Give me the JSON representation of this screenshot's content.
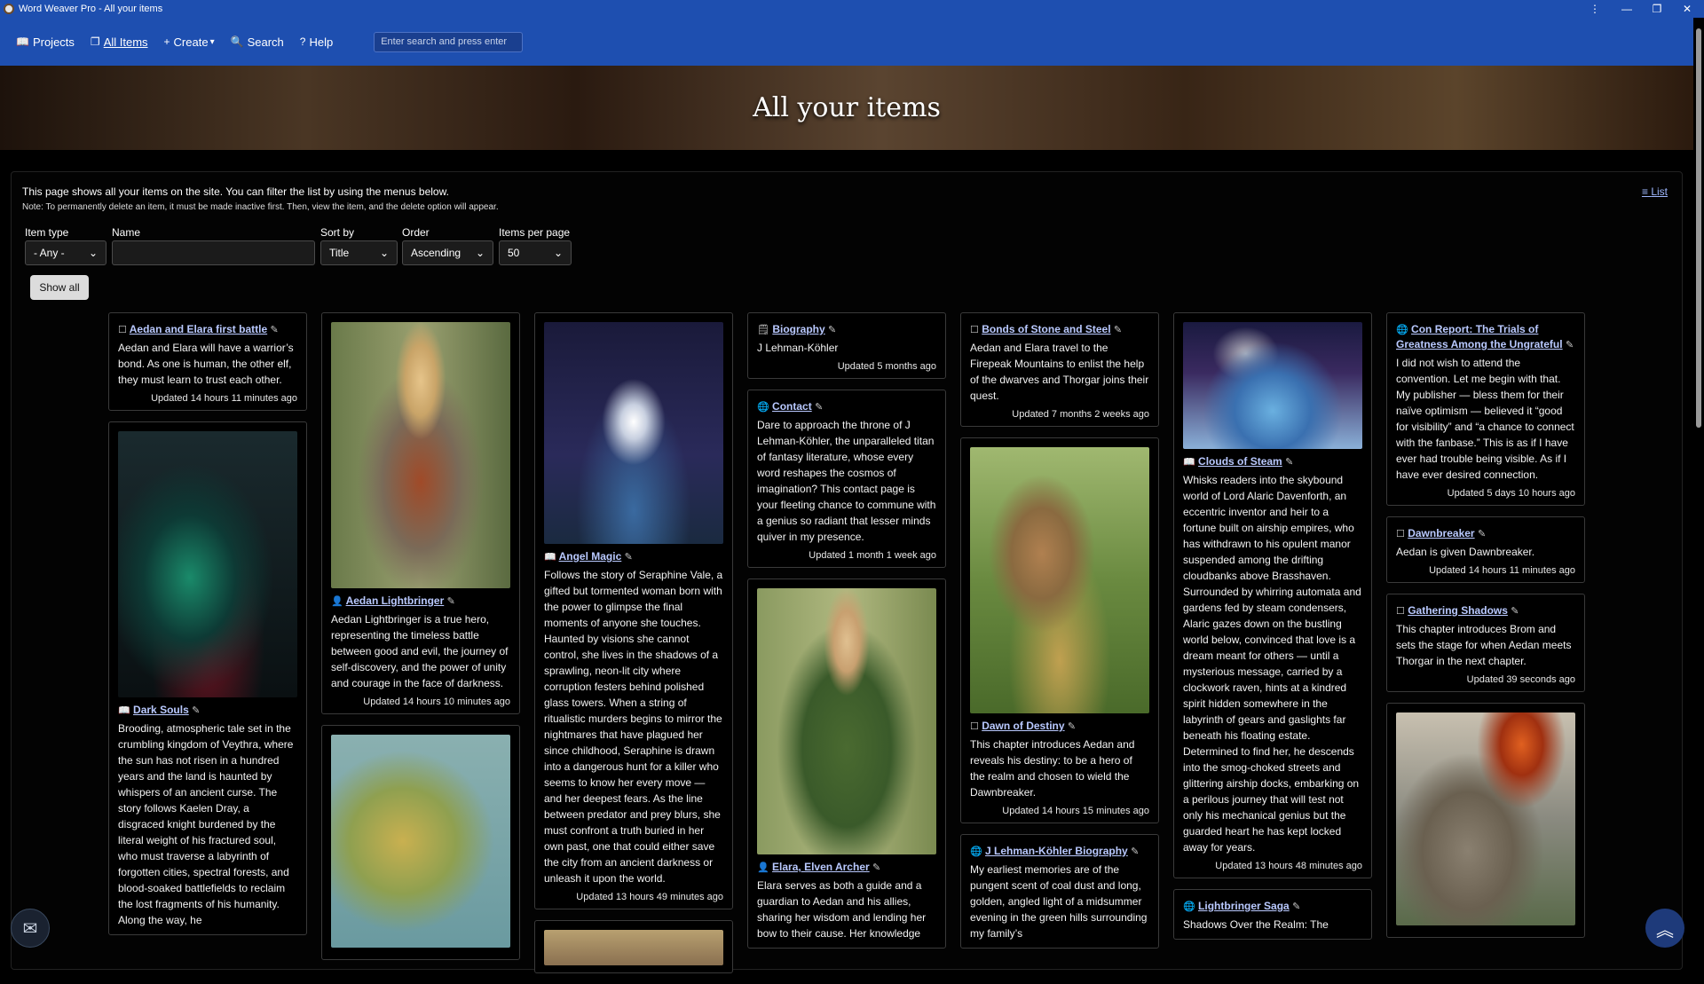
{
  "window": {
    "title": "Word Weaver Pro - All your items",
    "menu_icon": "⋮",
    "minimize_icon": "—",
    "maximize_icon": "❐",
    "close_icon": "✕"
  },
  "nav": {
    "projects": {
      "icon": "📖",
      "label": "Projects"
    },
    "all_items": {
      "icon": "❐",
      "label": "All Items"
    },
    "create": {
      "icon": "+",
      "label": "Create",
      "caret": "▾"
    },
    "search": {
      "icon": "🔍",
      "label": "Search"
    },
    "help": {
      "icon": "?",
      "label": "Help"
    },
    "search_placeholder": "Enter search and press enter"
  },
  "banner": {
    "title": "All your items"
  },
  "intro": {
    "line1": "This page shows all your items on the site. You can filter the list by using the menus below.",
    "line2": "Note: To permanently delete an item, it must be made inactive first. Then, view the item, and the delete option will appear."
  },
  "list_link": {
    "icon": "≡",
    "label": "List"
  },
  "filters": {
    "item_type": {
      "label": "Item type",
      "value": "- Any -"
    },
    "name": {
      "label": "Name",
      "value": ""
    },
    "sort_by": {
      "label": "Sort by",
      "value": "Title"
    },
    "order": {
      "label": "Order",
      "value": "Ascending"
    },
    "per_page": {
      "label": "Items per page",
      "value": "50"
    },
    "caret": "⌄"
  },
  "show_all": "Show all",
  "icons": {
    "edit": "✎",
    "page": "☐",
    "book": "📖",
    "person": "👤",
    "globe": "🌐",
    "note": "🗒"
  },
  "cards": {
    "c1": {
      "title": "Aedan and Elara first battle",
      "body": "Aedan and Elara will have a warrior’s bond. As one is human, the other elf, they must learn to trust each other.",
      "updated": "Updated 14 hours 11 minutes ago"
    },
    "c2": {
      "title": "Dark Souls",
      "body": "Brooding, atmospheric tale set in the crumbling kingdom of Veythra, where the sun has not risen in a hundred years and the land is haunted by whispers of an ancient curse. The story follows Kaelen Dray, a disgraced knight burdened by the literal weight of his fractured soul, who must traverse a labyrinth of forgotten cities, spectral forests, and blood-soaked battlefields to reclaim the lost fragments of his humanity. Along the way, he"
    },
    "c3": {
      "title": "Aedan Lightbringer",
      "body": "Aedan Lightbringer is a true hero, representing the timeless battle between good and evil, the journey of self-discovery, and the power of unity and courage in the face of darkness.",
      "updated": "Updated 14 hours 10 minutes ago"
    },
    "c5": {
      "title": "Angel Magic",
      "body": "Follows the story of Seraphine Vale, a gifted but tormented woman born with the power to glimpse the final moments of anyone she touches. Haunted by visions she cannot control, she lives in the shadows of a sprawling, neon-lit city where corruption festers behind polished glass towers. When a string of ritualistic murders begins to mirror the nightmares that have plagued her since childhood, Seraphine is drawn into a dangerous hunt for a killer who seems to know her every move — and her deepest fears. As the line between predator and prey blurs, she must confront a truth buried in her own past, one that could either save the city from an ancient darkness or unleash it upon the world.",
      "updated": "Updated 13 hours 49 minutes ago"
    },
    "c6": {
      "title": "Biography",
      "body": "J Lehman-Köhler",
      "updated": "Updated 5 months ago"
    },
    "c7": {
      "title": "Contact",
      "body": "Dare to approach the throne of J Lehman-Köhler, the unparalleled titan of fantasy literature, whose every word reshapes the cosmos of imagination? This contact page is your fleeting chance to commune with a genius so radiant that lesser minds quiver in my presence.",
      "updated": "Updated 1 month 1 week ago"
    },
    "c8": {
      "title": "Elara, Elven Archer",
      "body": "Elara serves as both a guide and a guardian to Aedan and his allies, sharing her wisdom and lending her bow to their cause. Her knowledge"
    },
    "c9": {
      "title": "Bonds of Stone and Steel",
      "body": "Aedan and Elara travel to the Firepeak Mountains to enlist the help of the dwarves and Thorgar joins their quest.",
      "updated": "Updated 7 months 2 weeks ago"
    },
    "c10": {
      "title": "Dawn of Destiny",
      "body": "This chapter introduces Aedan and reveals his destiny: to be a hero of the realm and chosen to wield the Dawnbreaker.",
      "updated": "Updated 14 hours 15 minutes ago"
    },
    "c11": {
      "title": "J Lehman-Köhler Biography",
      "body": "My earliest memories are of the pungent scent of coal dust and long, golden, angled light of a midsummer evening in the green hills surrounding my family’s"
    },
    "c12": {
      "title": "Clouds of Steam",
      "body": "Whisks readers into the skybound world of Lord Alaric Davenforth, an eccentric inventor and heir to a fortune built on airship empires, who has withdrawn to his opulent manor suspended among the drifting cloudbanks above Brasshaven. Surrounded by whirring automata and gardens fed by steam condensers, Alaric gazes down on the bustling world below, convinced that love is a dream meant for others — until a mysterious message, carried by a clockwork raven, hints at a kindred spirit hidden somewhere in the labyrinth of gears and gaslights far beneath his floating estate. Determined to find her, he descends into the smog-choked streets and glittering airship docks, embarking on a perilous journey that will test not only his mechanical genius but the guarded heart he has kept locked away for years.",
      "updated": "Updated 13 hours 48 minutes ago"
    },
    "c13": {
      "title": "Lightbringer Saga",
      "body": "Shadows Over the Realm: The"
    },
    "c14": {
      "title": "Con Report: The Trials of Greatness Among the Ungrateful",
      "body": "I did not wish to attend the convention. Let me begin with that. My publisher — bless them for their naïve optimism — believed it “good for visibility” and “a chance to connect with the fanbase.” This is as if I have ever had trouble being visible. As if I have ever desired connection.",
      "updated": "Updated 5 days 10 hours ago"
    },
    "c15": {
      "title": "Dawnbreaker",
      "body": "Aedan is given Dawnbreaker.",
      "updated": "Updated 14 hours 11 minutes ago"
    },
    "c16": {
      "title": "Gathering Shadows",
      "body": "This chapter introduces Brom and sets the stage for when Aedan meets Thorgar in the next chapter.",
      "updated": "Updated 39 seconds ago"
    }
  },
  "fab": {
    "message_icon": "✉",
    "up_icon": "︽"
  }
}
